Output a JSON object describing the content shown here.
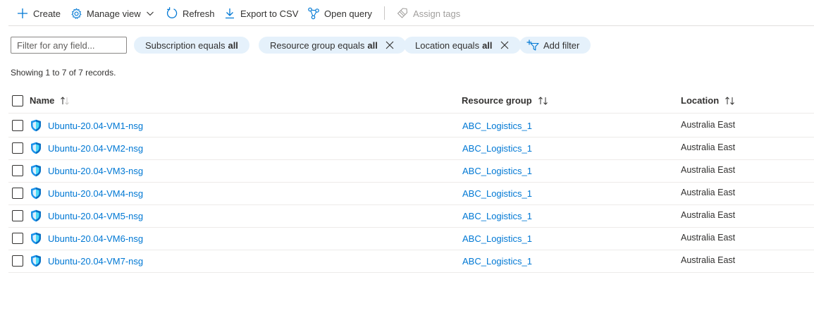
{
  "toolbar": {
    "create": "Create",
    "manage_view": "Manage view",
    "refresh": "Refresh",
    "export_csv": "Export to CSV",
    "open_query": "Open query",
    "assign_tags": "Assign tags",
    "icons": [
      "plus-icon",
      "gear-icon",
      "chevron-down-icon",
      "refresh-icon",
      "download-icon",
      "query-icon",
      "tag-icon"
    ]
  },
  "filters": {
    "placeholder": "Filter for any field...",
    "subscription": {
      "label": "Subscription equals",
      "value": "all"
    },
    "resource_group": {
      "label": "Resource group equals",
      "value": "all"
    },
    "location": {
      "label": "Location equals",
      "value": "all"
    },
    "add_filter": "Add filter"
  },
  "records_text": "Showing 1 to 7 of 7 records.",
  "table": {
    "columns": {
      "name": "Name",
      "resource_group": "Resource group",
      "location": "Location"
    },
    "rows": [
      {
        "name": "Ubuntu-20.04-VM1-nsg",
        "resource_group": "ABC_Logistics_1",
        "location": "Australia East"
      },
      {
        "name": "Ubuntu-20.04-VM2-nsg",
        "resource_group": "ABC_Logistics_1",
        "location": "Australia East"
      },
      {
        "name": "Ubuntu-20.04-VM3-nsg",
        "resource_group": "ABC_Logistics_1",
        "location": "Australia East"
      },
      {
        "name": "Ubuntu-20.04-VM4-nsg",
        "resource_group": "ABC_Logistics_1",
        "location": "Australia East"
      },
      {
        "name": "Ubuntu-20.04-VM5-nsg",
        "resource_group": "ABC_Logistics_1",
        "location": "Australia East"
      },
      {
        "name": "Ubuntu-20.04-VM6-nsg",
        "resource_group": "ABC_Logistics_1",
        "location": "Australia East"
      },
      {
        "name": "Ubuntu-20.04-VM7-nsg",
        "resource_group": "ABC_Logistics_1",
        "location": "Australia East"
      }
    ]
  },
  "colors": {
    "accent": "#0078d4",
    "pill_bg": "#e5f1fb",
    "text": "#323130",
    "disabled": "#a19f9d"
  }
}
